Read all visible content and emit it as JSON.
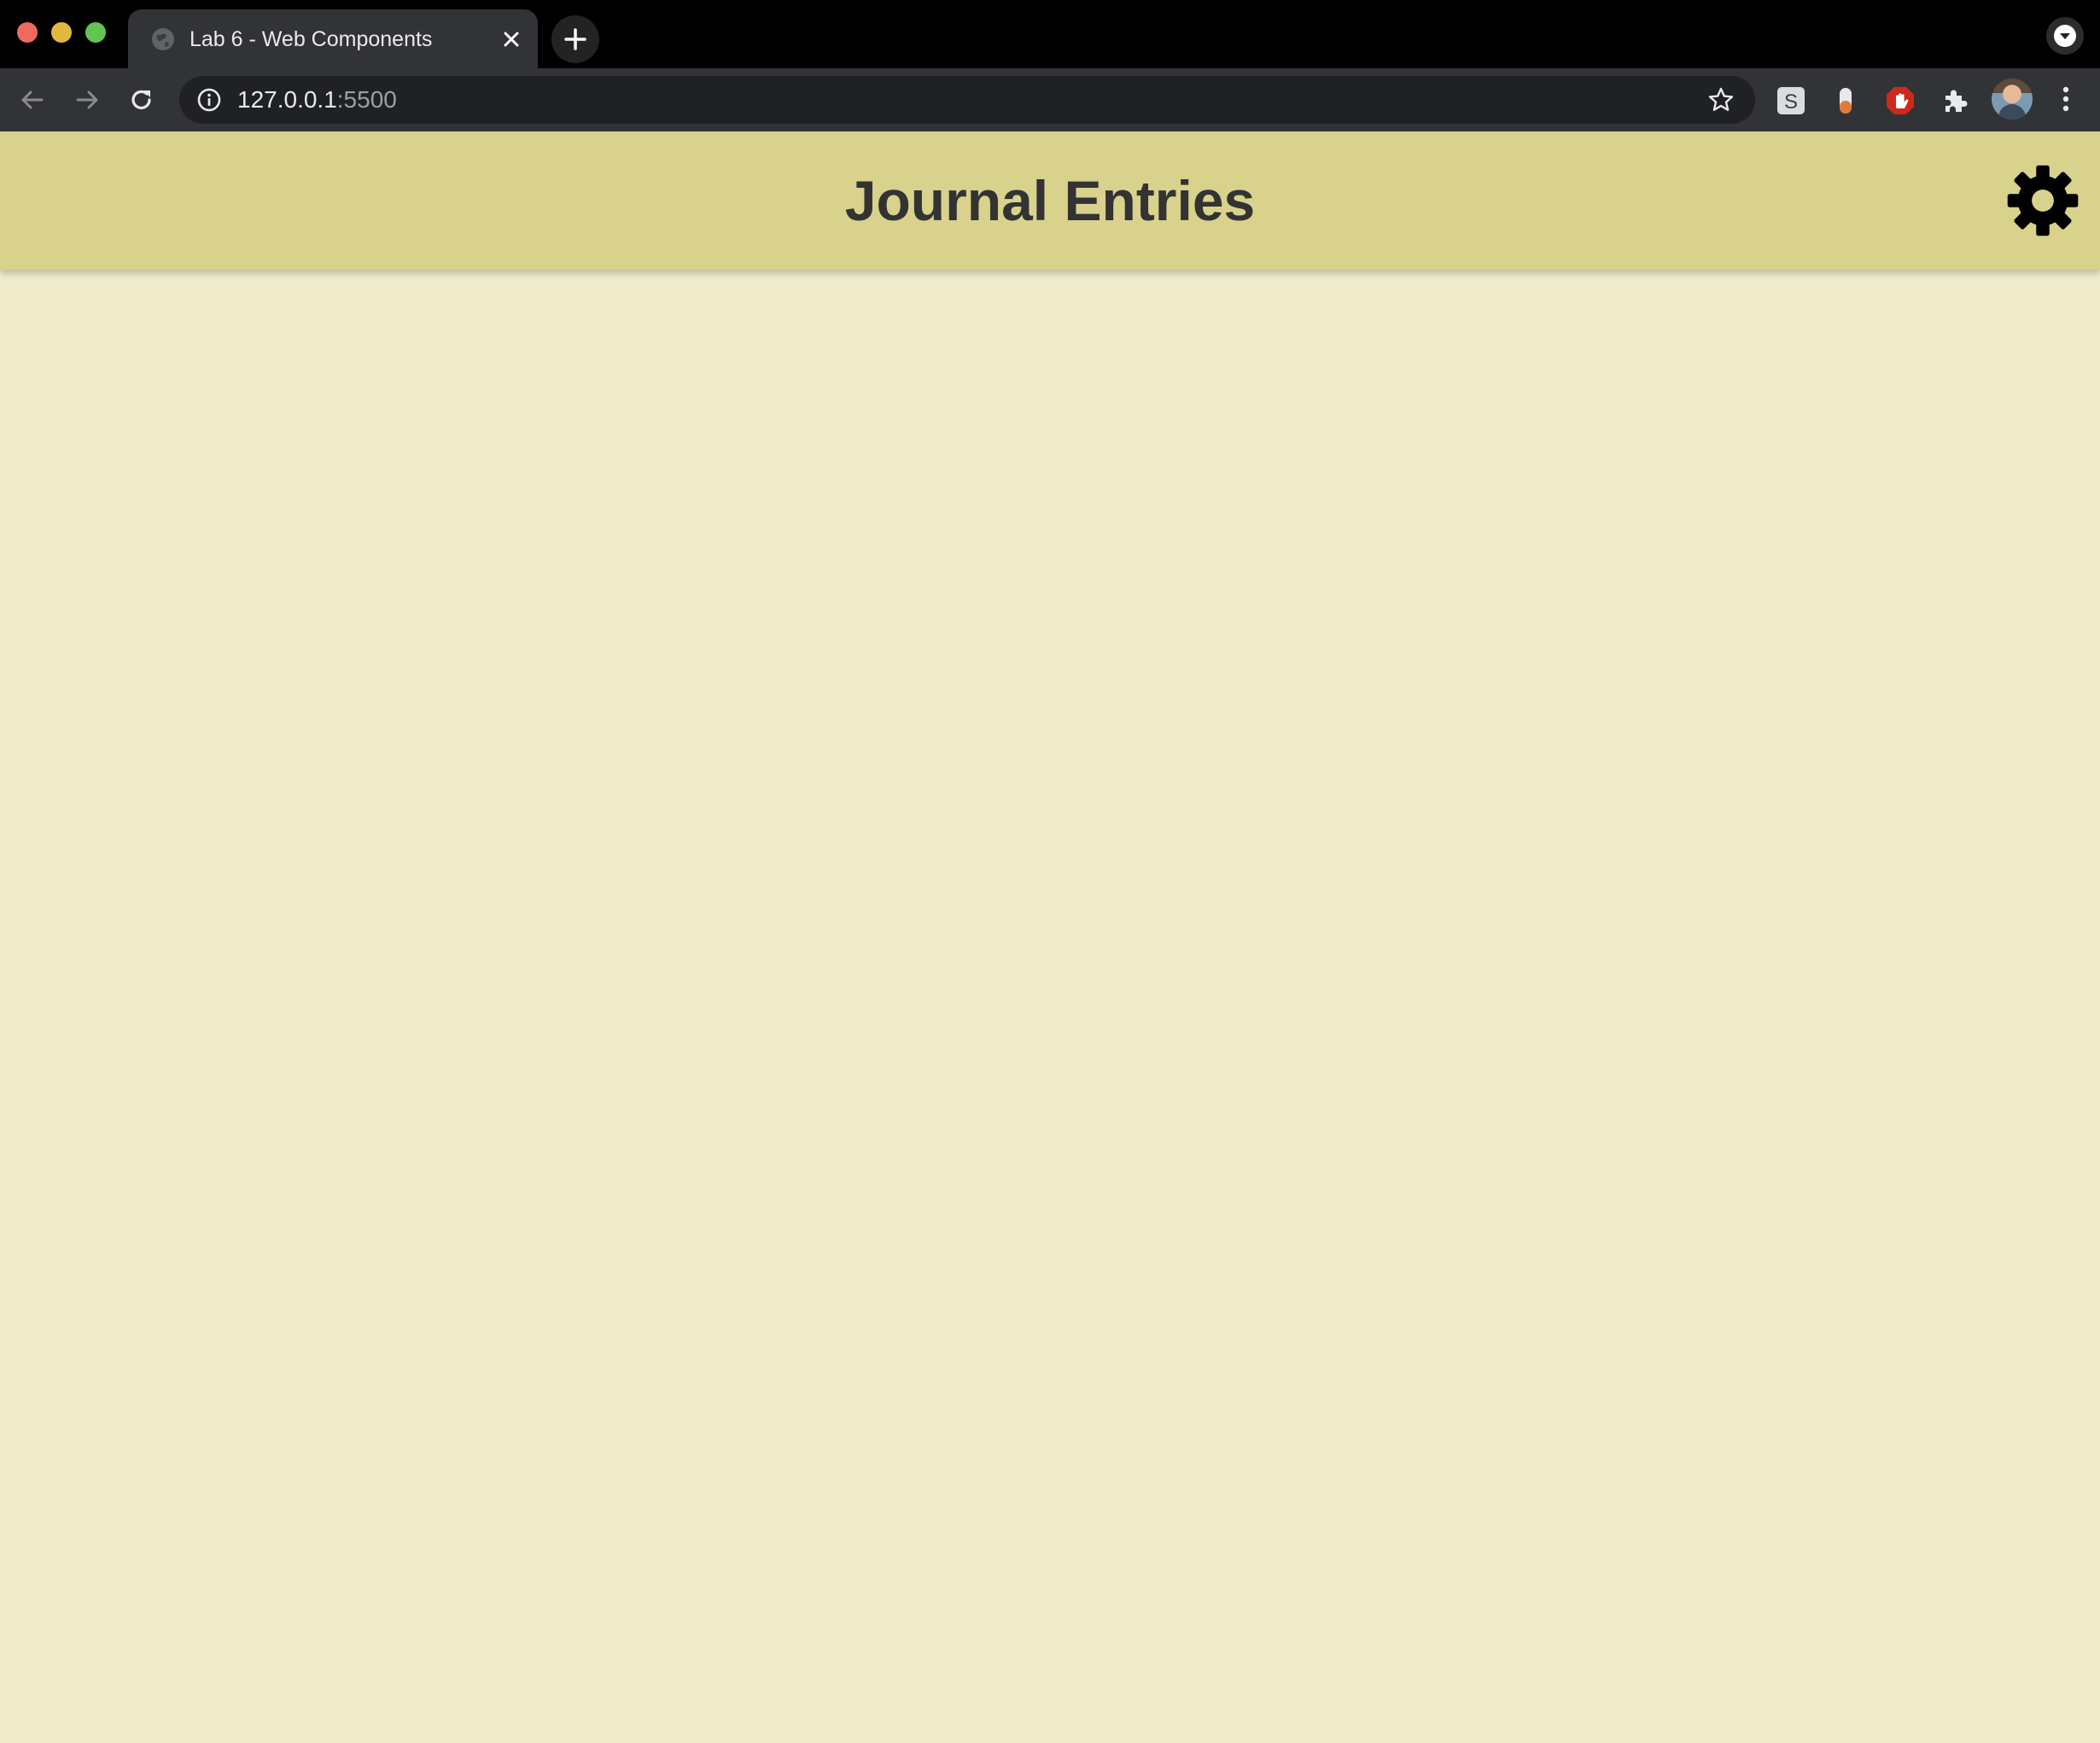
{
  "browser": {
    "tab": {
      "title": "Lab 6 - Web Components",
      "favicon": "globe-icon"
    },
    "address_bar": {
      "host": "127.0.0.1",
      "port": ":5500"
    },
    "colors": {
      "chrome_bg": "#000000",
      "toolbar_bg": "#323336",
      "omnibox_bg": "#202124"
    },
    "extensions": [
      "s-extension-icon",
      "capsule-extension-icon",
      "block-hand-extension-icon",
      "puzzle-icon"
    ]
  },
  "page": {
    "header": {
      "title": "Journal Entries",
      "settings_icon": "gear-icon"
    },
    "colors": {
      "header_bg": "#d9d28c",
      "page_bg": "#efebcb",
      "title_color": "#333333"
    },
    "entries": []
  }
}
